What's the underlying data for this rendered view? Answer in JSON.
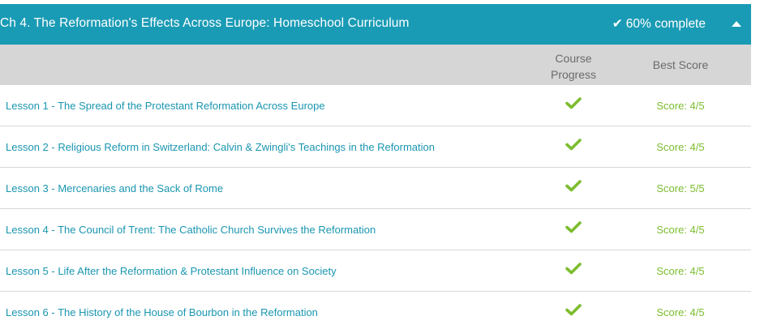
{
  "chapter": {
    "title": "Ch 4. The Reformation's Effects Across Europe: Homeschool Curriculum",
    "progress_label": "60% complete",
    "progress_fraction": 0.6,
    "header_color": "#1a9bb5"
  },
  "columns": {
    "progress_line1": "Course",
    "progress_line2": "Progress",
    "best_score": "Best Score"
  },
  "lessons": [
    {
      "title": "Lesson 1 - The Spread of the Protestant Reformation Across Europe",
      "completed": true,
      "score": "Score: 4/5"
    },
    {
      "title": "Lesson 2 - Religious Reform in Switzerland: Calvin & Zwingli's Teachings in the Reformation",
      "completed": true,
      "score": "Score: 4/5"
    },
    {
      "title": "Lesson 3 - Mercenaries and the Sack of Rome",
      "completed": true,
      "score": "Score: 5/5"
    },
    {
      "title": "Lesson 4 - The Council of Trent: The Catholic Church Survives the Reformation",
      "completed": true,
      "score": "Score: 4/5"
    },
    {
      "title": "Lesson 5 - Life After the Reformation & Protestant Influence on Society",
      "completed": true,
      "score": "Score: 4/5"
    },
    {
      "title": "Lesson 6 - The History of the House of Bourbon in the Reformation",
      "completed": true,
      "score": "Score: 4/5"
    }
  ],
  "colors": {
    "link": "#1a96b0",
    "check": "#7cbd2f",
    "score": "#7cbd2f"
  }
}
